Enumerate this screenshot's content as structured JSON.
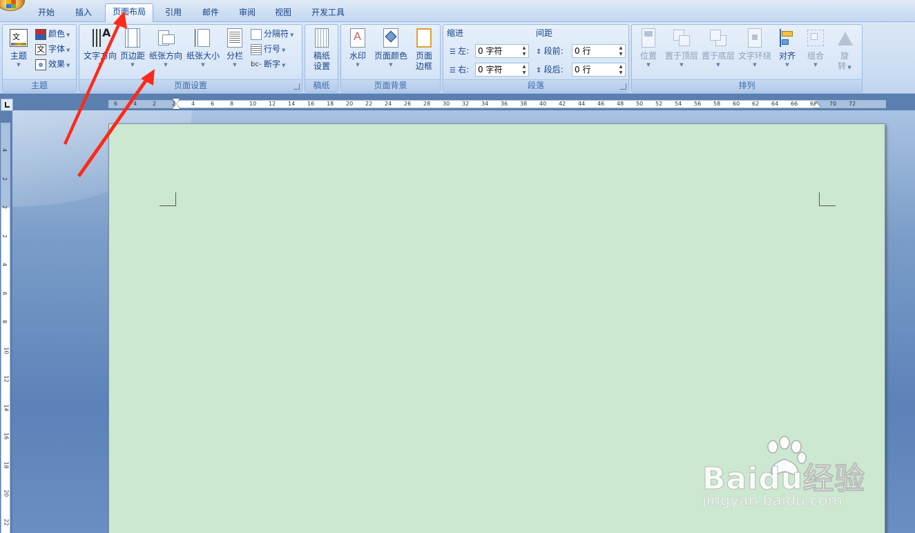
{
  "tabs": [
    "开始",
    "插入",
    "页面布局",
    "引用",
    "邮件",
    "审阅",
    "视图",
    "开发工具"
  ],
  "active_tab_index": 2,
  "groups": {
    "theme": {
      "title": "主题",
      "theme_btn": "主题",
      "colors": "颜色",
      "fonts": "字体",
      "effects": "效果"
    },
    "page_setup": {
      "title": "页面设置",
      "text_direction": "文字方向",
      "margins": "页边距",
      "orientation": "纸张方向",
      "size": "纸张大小",
      "columns": "分栏",
      "breaks": "分隔符",
      "line_numbers": "行号",
      "hyphenation": "断字"
    },
    "manuscript": {
      "title": "稿纸",
      "settings_line1": "稿纸",
      "settings_line2": "设置"
    },
    "page_background": {
      "title": "页面背景",
      "watermark": "水印",
      "page_color": "页面颜色",
      "border_line1": "页面",
      "border_line2": "边框"
    },
    "paragraph": {
      "title": "段落",
      "indent_header": "缩进",
      "indent_left_label": "左:",
      "indent_left_value": "0 字符",
      "indent_right_label": "右:",
      "indent_right_value": "0 字符",
      "spacing_header": "间距",
      "spacing_before_label": "段前:",
      "spacing_before_value": "0 行",
      "spacing_after_label": "段后:",
      "spacing_after_value": "0 行"
    },
    "arrange": {
      "title": "排列",
      "position": "位置",
      "bring_front": "置于顶层",
      "send_back": "置于底层",
      "text_wrap": "文字环绕",
      "align": "对齐",
      "group": "组合",
      "rotate_line1": "旋",
      "rotate_line2": "转"
    }
  },
  "ruler": {
    "h_labels": [
      "6",
      "4",
      "2",
      "2",
      "4",
      "6",
      "8",
      "10",
      "12",
      "14",
      "16",
      "18",
      "20",
      "22",
      "24",
      "26",
      "28",
      "30",
      "32",
      "34",
      "36",
      "38",
      "40",
      "42",
      "44",
      "46",
      "48",
      "50",
      "52",
      "54",
      "56",
      "58",
      "60",
      "62",
      "64",
      "66",
      "68",
      "70",
      "72"
    ],
    "v_labels": [
      "4",
      "2",
      "2",
      "2",
      "4",
      "6",
      "8",
      "10",
      "12",
      "14",
      "16",
      "18",
      "20",
      "22"
    ]
  },
  "watermark": {
    "brand": "Baidu经验",
    "url": "jingyan.baidu.com"
  },
  "colors": {
    "page_bg": "#cde8d1",
    "arrow": "#ff2a1a",
    "accent_text": "#15428b"
  }
}
